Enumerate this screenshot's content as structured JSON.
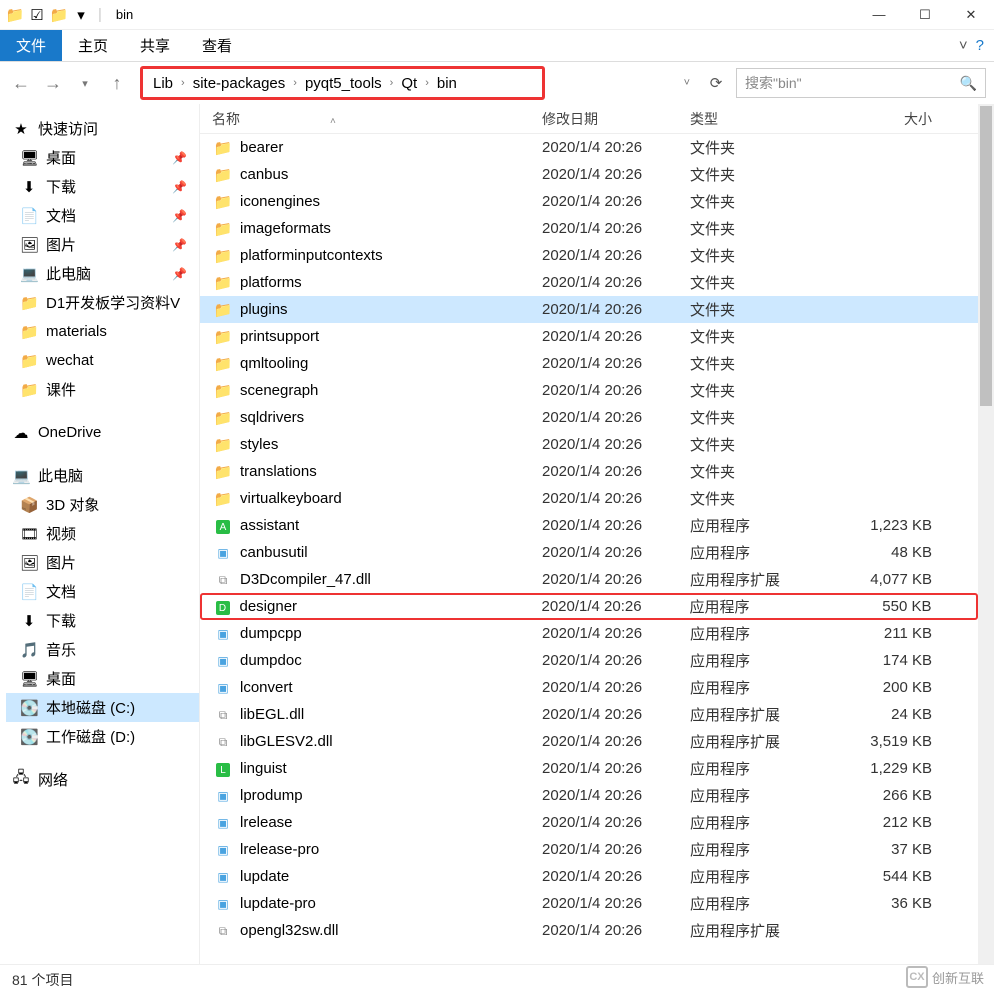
{
  "title": "bin",
  "ribbon": {
    "file": "文件",
    "home": "主页",
    "share": "共享",
    "view": "查看"
  },
  "breadcrumb": [
    "Lib",
    "site-packages",
    "pyqt5_tools",
    "Qt",
    "bin"
  ],
  "search_placeholder": "搜索\"bin\"",
  "columns": {
    "name": "名称",
    "date": "修改日期",
    "type": "类型",
    "size": "大小"
  },
  "sidebar": {
    "quick": {
      "label": "快速访问",
      "items": [
        {
          "icon": "🖥",
          "label": "桌面",
          "pinned": true
        },
        {
          "icon": "⬇",
          "label": "下载",
          "pinned": true
        },
        {
          "icon": "📄",
          "label": "文档",
          "pinned": true
        },
        {
          "icon": "🖼",
          "label": "图片",
          "pinned": true
        },
        {
          "icon": "💻",
          "label": "此电脑",
          "pinned": true
        },
        {
          "icon": "📁",
          "label": "D1开发板学习资料V",
          "pinned": false
        },
        {
          "icon": "📁",
          "label": "materials",
          "pinned": false
        },
        {
          "icon": "📁",
          "label": "wechat",
          "pinned": false
        },
        {
          "icon": "📁",
          "label": "课件",
          "pinned": false
        }
      ]
    },
    "onedrive": {
      "icon": "☁",
      "label": "OneDrive"
    },
    "thispc": {
      "label": "此电脑",
      "items": [
        {
          "icon": "📦",
          "label": "3D 对象"
        },
        {
          "icon": "🎞",
          "label": "视频"
        },
        {
          "icon": "🖼",
          "label": "图片"
        },
        {
          "icon": "📄",
          "label": "文档"
        },
        {
          "icon": "⬇",
          "label": "下载"
        },
        {
          "icon": "🎵",
          "label": "音乐"
        },
        {
          "icon": "🖥",
          "label": "桌面"
        },
        {
          "icon": "💽",
          "label": "本地磁盘 (C:)",
          "selected": true
        },
        {
          "icon": "💽",
          "label": "工作磁盘 (D:)"
        }
      ]
    },
    "network": {
      "icon": "🖧",
      "label": "网络"
    }
  },
  "files": [
    {
      "icon": "folder",
      "name": "bearer",
      "date": "2020/1/4 20:26",
      "type": "文件夹",
      "size": ""
    },
    {
      "icon": "folder",
      "name": "canbus",
      "date": "2020/1/4 20:26",
      "type": "文件夹",
      "size": ""
    },
    {
      "icon": "folder",
      "name": "iconengines",
      "date": "2020/1/4 20:26",
      "type": "文件夹",
      "size": ""
    },
    {
      "icon": "folder",
      "name": "imageformats",
      "date": "2020/1/4 20:26",
      "type": "文件夹",
      "size": ""
    },
    {
      "icon": "folder",
      "name": "platforminputcontexts",
      "date": "2020/1/4 20:26",
      "type": "文件夹",
      "size": ""
    },
    {
      "icon": "folder",
      "name": "platforms",
      "date": "2020/1/4 20:26",
      "type": "文件夹",
      "size": ""
    },
    {
      "icon": "folder",
      "name": "plugins",
      "date": "2020/1/4 20:26",
      "type": "文件夹",
      "size": "",
      "selected": true
    },
    {
      "icon": "folder",
      "name": "printsupport",
      "date": "2020/1/4 20:26",
      "type": "文件夹",
      "size": ""
    },
    {
      "icon": "folder",
      "name": "qmltooling",
      "date": "2020/1/4 20:26",
      "type": "文件夹",
      "size": ""
    },
    {
      "icon": "folder",
      "name": "scenegraph",
      "date": "2020/1/4 20:26",
      "type": "文件夹",
      "size": ""
    },
    {
      "icon": "folder",
      "name": "sqldrivers",
      "date": "2020/1/4 20:26",
      "type": "文件夹",
      "size": ""
    },
    {
      "icon": "folder",
      "name": "styles",
      "date": "2020/1/4 20:26",
      "type": "文件夹",
      "size": ""
    },
    {
      "icon": "folder",
      "name": "translations",
      "date": "2020/1/4 20:26",
      "type": "文件夹",
      "size": ""
    },
    {
      "icon": "folder",
      "name": "virtualkeyboard",
      "date": "2020/1/4 20:26",
      "type": "文件夹",
      "size": ""
    },
    {
      "icon": "greenA",
      "name": "assistant",
      "date": "2020/1/4 20:26",
      "type": "应用程序",
      "size": "1,223 KB"
    },
    {
      "icon": "exe",
      "name": "canbusutil",
      "date": "2020/1/4 20:26",
      "type": "应用程序",
      "size": "48 KB"
    },
    {
      "icon": "dll",
      "name": "D3Dcompiler_47.dll",
      "date": "2020/1/4 20:26",
      "type": "应用程序扩展",
      "size": "4,077 KB"
    },
    {
      "icon": "greenD",
      "name": "designer",
      "date": "2020/1/4 20:26",
      "type": "应用程序",
      "size": "550 KB",
      "highlighted": true
    },
    {
      "icon": "exe",
      "name": "dumpcpp",
      "date": "2020/1/4 20:26",
      "type": "应用程序",
      "size": "211 KB"
    },
    {
      "icon": "exe",
      "name": "dumpdoc",
      "date": "2020/1/4 20:26",
      "type": "应用程序",
      "size": "174 KB"
    },
    {
      "icon": "exe",
      "name": "lconvert",
      "date": "2020/1/4 20:26",
      "type": "应用程序",
      "size": "200 KB"
    },
    {
      "icon": "dll",
      "name": "libEGL.dll",
      "date": "2020/1/4 20:26",
      "type": "应用程序扩展",
      "size": "24 KB"
    },
    {
      "icon": "dll",
      "name": "libGLESV2.dll",
      "date": "2020/1/4 20:26",
      "type": "应用程序扩展",
      "size": "3,519 KB"
    },
    {
      "icon": "greenL",
      "name": "linguist",
      "date": "2020/1/4 20:26",
      "type": "应用程序",
      "size": "1,229 KB"
    },
    {
      "icon": "exe",
      "name": "lprodump",
      "date": "2020/1/4 20:26",
      "type": "应用程序",
      "size": "266 KB"
    },
    {
      "icon": "exe",
      "name": "lrelease",
      "date": "2020/1/4 20:26",
      "type": "应用程序",
      "size": "212 KB"
    },
    {
      "icon": "exe",
      "name": "lrelease-pro",
      "date": "2020/1/4 20:26",
      "type": "应用程序",
      "size": "37 KB"
    },
    {
      "icon": "exe",
      "name": "lupdate",
      "date": "2020/1/4 20:26",
      "type": "应用程序",
      "size": "544 KB"
    },
    {
      "icon": "exe",
      "name": "lupdate-pro",
      "date": "2020/1/4 20:26",
      "type": "应用程序",
      "size": "36 KB"
    },
    {
      "icon": "dll",
      "name": "opengl32sw.dll",
      "date": "2020/1/4 20:26",
      "type": "应用程序扩展",
      "size": ""
    }
  ],
  "status": "81 个项目",
  "watermark": "创新互联"
}
